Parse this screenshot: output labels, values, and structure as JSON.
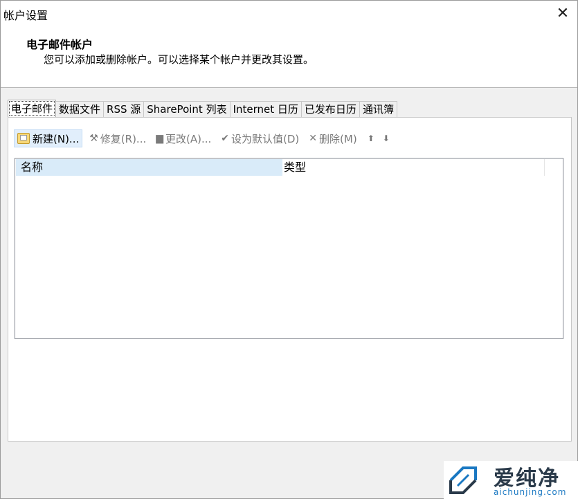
{
  "window": {
    "title": "帐户设置",
    "close_glyph": "✕"
  },
  "header": {
    "title": "电子邮件帐户",
    "description": "您可以添加或删除帐户。可以选择某个帐户并更改其设置。"
  },
  "tabs": [
    {
      "label": "电子邮件",
      "active": true
    },
    {
      "label": "数据文件"
    },
    {
      "label": "RSS 源"
    },
    {
      "label": "SharePoint 列表"
    },
    {
      "label": "Internet 日历"
    },
    {
      "label": "已发布日历"
    },
    {
      "label": "通讯簿"
    }
  ],
  "toolbar": {
    "new_label": "新建(N)...",
    "repair_label": "修复(R)...",
    "repair_icon": "⚒",
    "change_label": "更改(A)...",
    "change_icon": "▆",
    "default_label": "设为默认值(D)",
    "default_icon": "✔",
    "remove_label": "删除(M)",
    "remove_icon": "✕",
    "up_icon": "⬆",
    "down_icon": "⬇"
  },
  "list": {
    "columns": [
      "名称",
      "类型"
    ],
    "rows": []
  },
  "watermark": {
    "name": "爱纯净",
    "url": "aichunjing.com"
  },
  "colors": {
    "accent": "#1a78c2",
    "selected_header": "#d9ebf9"
  }
}
